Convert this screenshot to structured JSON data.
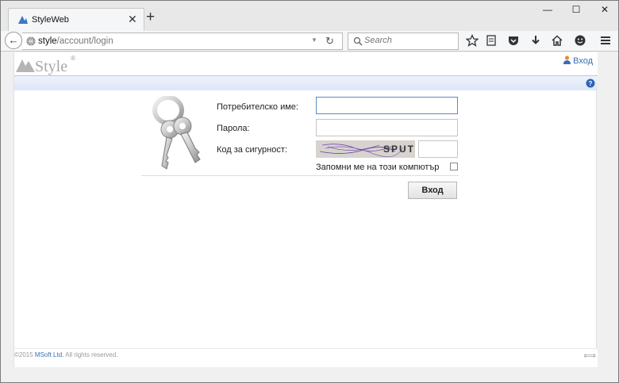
{
  "tab": {
    "title": "StyleWeb",
    "close": "✕",
    "new_tab": "+"
  },
  "window": {
    "minimize": "—",
    "maximize": "☐",
    "close": "✕"
  },
  "nav": {
    "url_host": "style",
    "url_path": "/account/login",
    "search_placeholder": "Search"
  },
  "site": {
    "logo_text": "Style",
    "logo_mark": "®",
    "login_link": "Вход"
  },
  "form": {
    "username_label": "Потребителско име:",
    "password_label": "Парола:",
    "captcha_label": "Код за сигурност:",
    "captcha_text": "SPUT",
    "remember_label": "Запомни ме на този компютър",
    "submit_label": "Вход",
    "username_value": "",
    "password_value": "",
    "captcha_value": ""
  },
  "footer": {
    "copyright": "©2015 ",
    "company": "MSoft Ltd.",
    "rights": " All rights reserved."
  },
  "colors": {
    "accent": "#3a6fb5",
    "focus_border": "#5a8ac6",
    "bar": "#dde7f7"
  }
}
